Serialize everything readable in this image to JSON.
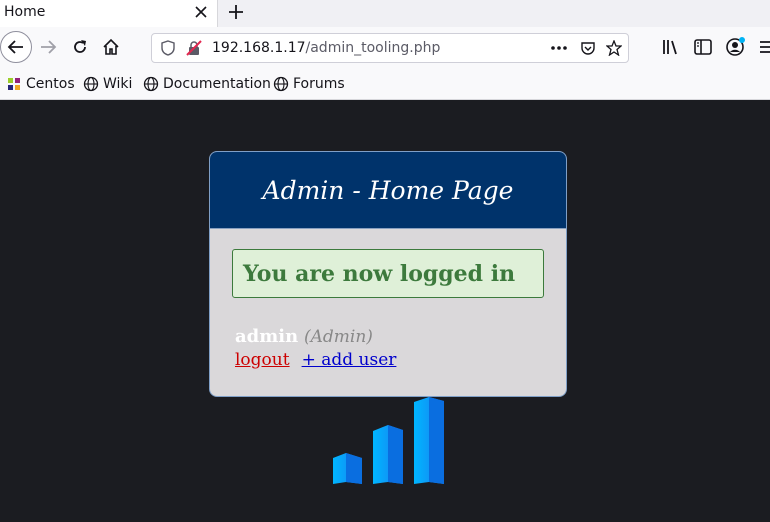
{
  "browser": {
    "tab": {
      "title": "Home"
    },
    "url": {
      "host": "192.168.1.17",
      "path": "/admin_tooling.php"
    },
    "bookmarks": [
      {
        "label": "Centos",
        "icon": "centos-icon"
      },
      {
        "label": "Wiki",
        "icon": "globe-icon"
      },
      {
        "label": "Documentation",
        "icon": "globe-icon"
      },
      {
        "label": "Forums",
        "icon": "globe-icon"
      }
    ]
  },
  "page": {
    "title": "Admin - Home Page",
    "success_message": "You are now logged in",
    "user": {
      "name": "admin",
      "role": "(Admin)"
    },
    "links": {
      "logout": "logout",
      "add_user": "+ add user"
    }
  },
  "colors": {
    "page_background": "#1b1c21",
    "header_background": "#00336b",
    "card_background": "#dad8da",
    "success_background": "#dff0d8",
    "success_text": "#3d7a3d",
    "logout_link": "#cc0000",
    "add_user_link": "#0000cc",
    "logo_blue": "#1488f0"
  }
}
